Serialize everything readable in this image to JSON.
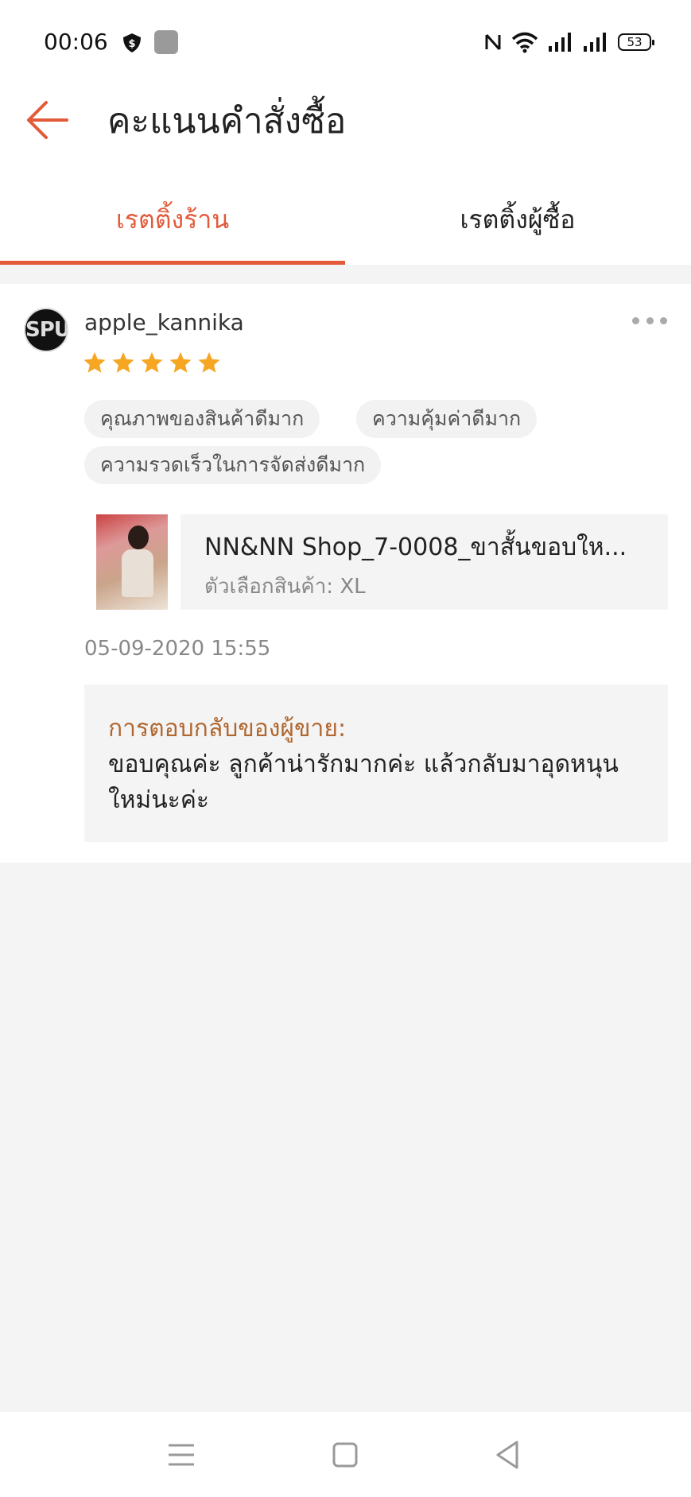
{
  "status_bar": {
    "time": "00:06",
    "battery": "53"
  },
  "header": {
    "title": "คะแนนคำสั่งซื้อ"
  },
  "tabs": [
    {
      "label": "เรตติ้งร้าน",
      "active": true
    },
    {
      "label": "เรตติ้งผู้ซื้อ",
      "active": false
    }
  ],
  "review": {
    "avatar_text": "SPU",
    "username": "apple_kannika",
    "rating": 5,
    "tags": [
      "คุณภาพของสินค้าดีมาก",
      "ความคุ้มค่าดีมาก",
      "ความรวดเร็วในการจัดส่งดีมาก"
    ],
    "product": {
      "name": "NN&NN Shop_7-0008_ขาสั้นขอบให...",
      "variant": "ตัวเลือกสินค้า: XL"
    },
    "date": "05-09-2020 15:55",
    "seller_reply": {
      "label": "การตอบกลับของผู้ขาย:",
      "text": "ขอบคุณค่ะ ลูกค้าน่ารักมากค่ะ แล้วกลับมาอุดหนุนใหม่นะค่ะ"
    }
  },
  "colors": {
    "accent": "#e25a39",
    "star": "#f6a623",
    "reply_label": "#b0662e"
  }
}
